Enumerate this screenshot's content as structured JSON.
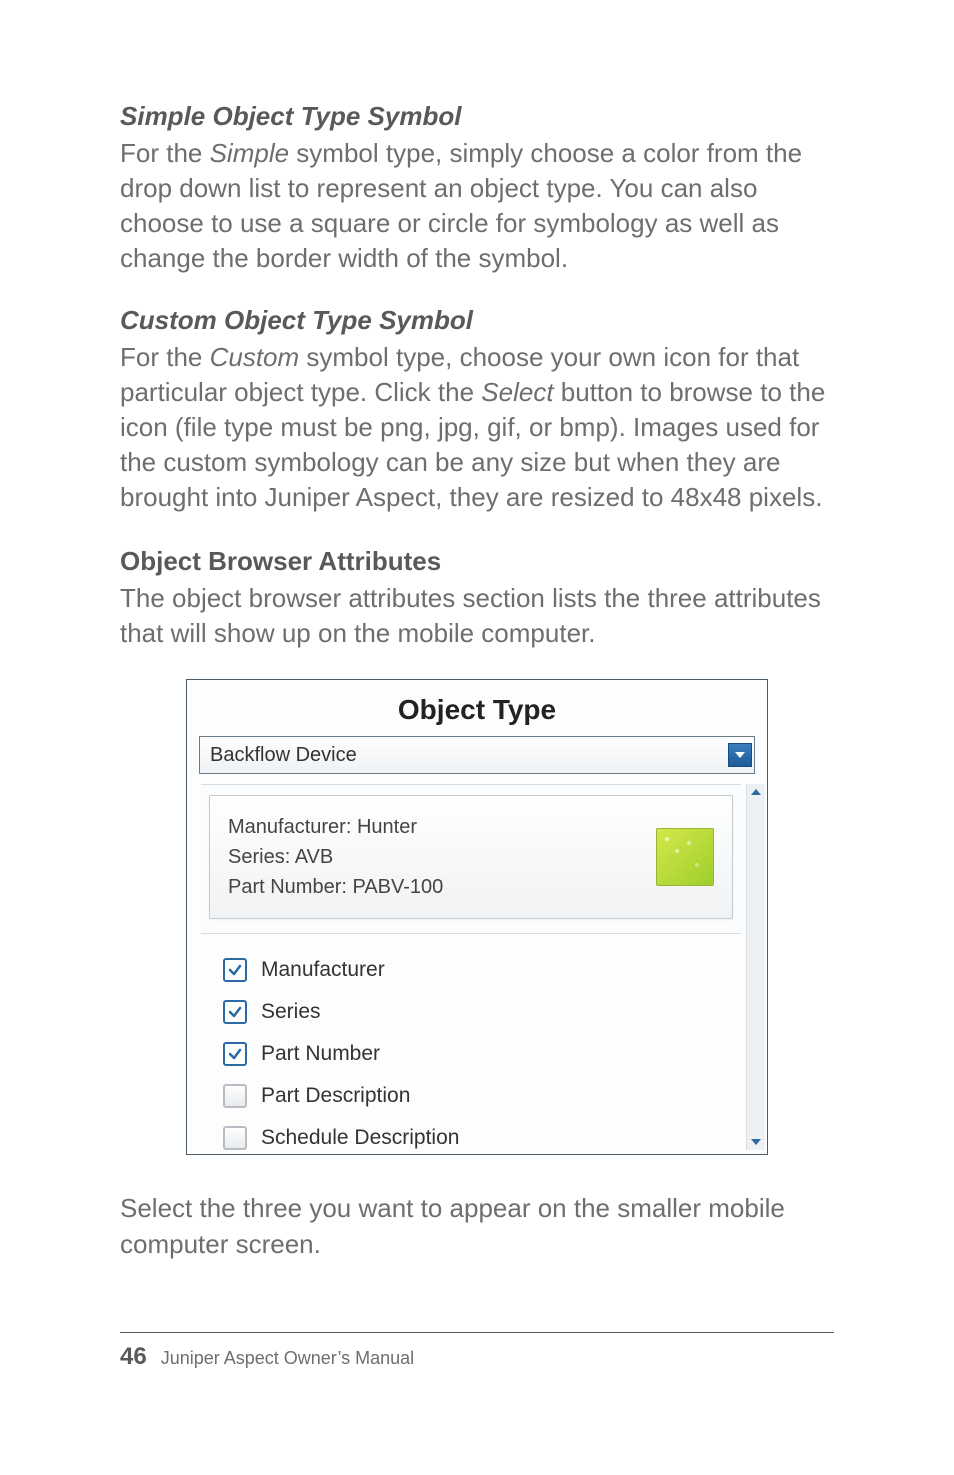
{
  "headings": {
    "simple": "Simple Object Type Symbol",
    "custom": "Custom Object Type Symbol",
    "browser": "Object Browser Attributes"
  },
  "paragraphs": {
    "simple_pre": "For the ",
    "simple_em": "Simple",
    "simple_post": " symbol type, simply choose a color from the drop down list to represent an object type. You can also choose to use a square or circle for symbology as well as change the border width of the symbol.",
    "custom_pre": "For the ",
    "custom_em1": "Custom",
    "custom_mid": " symbol type, choose your own icon for that particular object type. Click the ",
    "custom_em2": "Select",
    "custom_post": " button to browse to the icon (file type must be png, jpg, gif, or bmp). Images used for the custom symbology can be any size but when they are brought into Juniper Aspect, they are resized to 48x48 pixels.",
    "browser": "The object browser attributes section lists the three attributes that will show up on the mobile computer.",
    "after_figure": "Select the three you want to appear on the smaller mobile computer screen."
  },
  "figure": {
    "title": "Object Type",
    "combo_value": "Backflow Device",
    "preview": {
      "line1": "Manufacturer: Hunter",
      "line2": "Series: AVB",
      "line3": "Part Number: PABV-100"
    },
    "attributes": [
      {
        "label": "Manufacturer",
        "checked": true
      },
      {
        "label": "Series",
        "checked": true
      },
      {
        "label": "Part Number",
        "checked": true
      },
      {
        "label": "Part Description",
        "checked": false
      },
      {
        "label": "Schedule Description",
        "checked": false
      }
    ]
  },
  "footer": {
    "page": "46",
    "text": "Juniper Aspect Owner’s Manual"
  }
}
